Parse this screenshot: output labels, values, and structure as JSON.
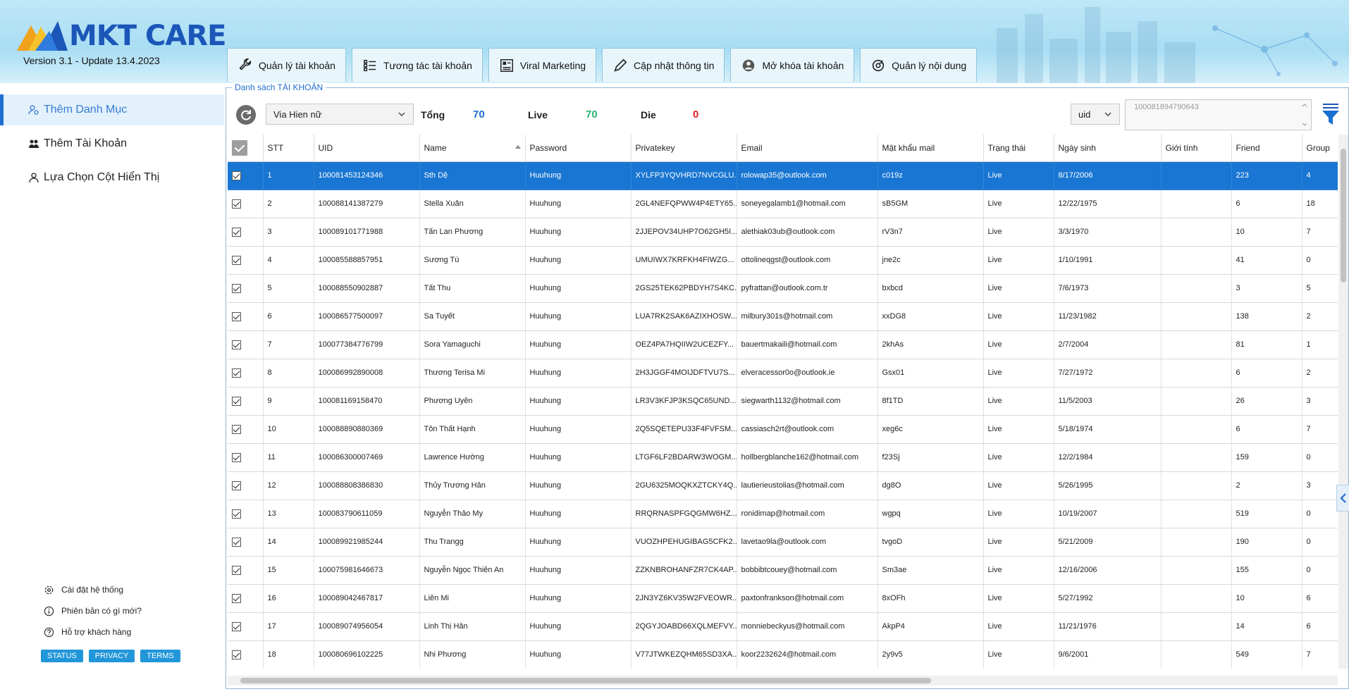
{
  "app": {
    "logo_text": "MKT CARE",
    "version": "Version 3.1 - Update 13.4.2023"
  },
  "tabs": [
    {
      "label": "Quản lý tài khoản",
      "icon": "wrench-icon"
    },
    {
      "label": "Tương tác tài khoản",
      "icon": "list-icon"
    },
    {
      "label": "Viral Marketing",
      "icon": "grid-icon"
    },
    {
      "label": "Cập nhật thông tin",
      "icon": "pencil-icon"
    },
    {
      "label": "Mở khóa tài khoản",
      "icon": "user-circle-icon"
    },
    {
      "label": "Quản lý nội dung",
      "icon": "gear-refresh-icon"
    }
  ],
  "sidebar": {
    "items": [
      {
        "label": "Thêm Danh Mục",
        "icon": "users-cog-icon",
        "active": true
      },
      {
        "label": "Thêm Tài Khoản",
        "icon": "users-icon",
        "active": false
      },
      {
        "label": "Lựa Chọn Cột Hiển Thị",
        "icon": "user-icon",
        "active": false
      }
    ],
    "footer_links": [
      {
        "label": "Cài đặt hệ thống",
        "icon": "gear-icon"
      },
      {
        "label": "Phiên bản có gì mới?",
        "icon": "info-icon"
      },
      {
        "label": "Hỗ trợ khách hàng",
        "icon": "help-icon"
      }
    ],
    "badges": [
      "STATUS",
      "PRIVACY",
      "TERMS"
    ]
  },
  "panel": {
    "legend": "Danh sách TÀI KHOẢN",
    "category_select": "Via Hien nữ",
    "total_label": "Tổng",
    "total_value": "70",
    "live_label": "Live",
    "live_value": "70",
    "die_label": "Die",
    "die_value": "0",
    "search_field_select": "uid",
    "uid_text": "100081894790643",
    "colors": {
      "total": "#1f6fd1",
      "live": "#2bb673",
      "die": "#e02020",
      "selected_row": "#1976d2"
    }
  },
  "table": {
    "columns": [
      "STT",
      "UID",
      "Name",
      "Password",
      "Privatekey",
      "Email",
      "Mật khẩu mail",
      "Trạng thái",
      "Ngày sinh",
      "Giới tính",
      "Friend",
      "Group"
    ],
    "rows": [
      [
        "1",
        "100081453124346",
        "Sth Dệ",
        "Huuhung",
        "XYLFP3YQVHRD7NVCGLU...",
        "rolowap35@outlook.com",
        "c019z",
        "Live",
        "8/17/2006",
        "",
        "223",
        "4"
      ],
      [
        "2",
        "100088141387279",
        "Stella Xuân",
        "Huuhung",
        "2GL4NEFQPWW4P4ETY65...",
        "soneyegalamb1@hotmail.com",
        "sB5GM",
        "Live",
        "12/22/1975",
        "",
        "6",
        "18"
      ],
      [
        "3",
        "100089101771988",
        "Tấn Lan Phương",
        "Huuhung",
        "2JJEPOV34UHP7O62GH5I...",
        "alethiak03ub@outlook.com",
        "rV3n7",
        "Live",
        "3/3/1970",
        "",
        "10",
        "7"
      ],
      [
        "4",
        "100085588857951",
        "Sương Tú",
        "Huuhung",
        "UMUIWX7KRFKH4FIWZG...",
        "ottolineqgst@outlook.com",
        "jne2c",
        "Live",
        "1/10/1991",
        "",
        "41",
        "0"
      ],
      [
        "5",
        "100088550902887",
        "Tất Thu",
        "Huuhung",
        "2GS25TEK62PBDYH7S4KC...",
        "pyfrattan@outlook.com.tr",
        "bxbcd",
        "Live",
        "7/6/1973",
        "",
        "3",
        "5"
      ],
      [
        "6",
        "100086577500097",
        "Sa Tuyết",
        "Huuhung",
        "LUA7RK2SAK6AZIXHOSW...",
        "milbury301s@hotmail.com",
        "xxDG8",
        "Live",
        "11/23/1982",
        "",
        "138",
        "2"
      ],
      [
        "7",
        "100077384776799",
        "Sora Yamaguchi",
        "Huuhung",
        "OEZ4PA7HQIIW2UCEZFY...",
        "bauertmakaili@hotmail.com",
        "2khAs",
        "Live",
        "2/7/2004",
        "",
        "81",
        "1"
      ],
      [
        "8",
        "100086992890008",
        "Thương Terisa Mi",
        "Huuhung",
        "2H3JGGF4MOIJDFTVU7S...",
        "elveracessor0o@outlook.ie",
        "Gsx01",
        "Live",
        "7/27/1972",
        "",
        "6",
        "2"
      ],
      [
        "9",
        "100081169158470",
        "Phương Uyên",
        "Huuhung",
        "LR3V3KFJP3KSQC65UND...",
        "siegwarth1132@hotmail.com",
        "8f1TD",
        "Live",
        "11/5/2003",
        "",
        "26",
        "3"
      ],
      [
        "10",
        "100088890880369",
        "Tôn Thất Hạnh",
        "Huuhung",
        "2Q5SQETEPU33F4FVFSM...",
        "cassiasch2rt@outlook.com",
        "xeg6c",
        "Live",
        "5/18/1974",
        "",
        "6",
        "7"
      ],
      [
        "11",
        "100086300007469",
        "Lawrence Hường",
        "Huuhung",
        "LTGF6LF2BDARW3WOGM...",
        "hollbergblanche162@hotmail.com",
        "f23Sj",
        "Live",
        "12/2/1984",
        "",
        "159",
        "0"
      ],
      [
        "12",
        "100088808386830",
        "Thủy Trương Hân",
        "Huuhung",
        "2GU6325MOQKXZTCKY4Q...",
        "lautierieustolias@hotmail.com",
        "dg8O",
        "Live",
        "5/26/1995",
        "",
        "2",
        "3"
      ],
      [
        "13",
        "100083790611059",
        "Nguyễn Thảo My",
        "Huuhung",
        "RRQRNASPFGQGMW6HZ...",
        "ronidimap@hotmail.com",
        "wgpq",
        "Live",
        "10/19/2007",
        "",
        "519",
        "0"
      ],
      [
        "14",
        "100089921985244",
        "Thu Trangg",
        "Huuhung",
        "VUOZHPEHUGIBAG5CFK2...",
        "lavetao9la@outlook.com",
        "tvgoD",
        "Live",
        "5/21/2009",
        "",
        "190",
        "0"
      ],
      [
        "15",
        "100075981646673",
        "Nguyễn Ngọc Thiên An",
        "Huuhung",
        "ZZKNBROHANFZR7CK4AP...",
        "bobbibtcouey@hotmail.com",
        "Sm3ae",
        "Live",
        "12/16/2006",
        "",
        "155",
        "0"
      ],
      [
        "16",
        "100089042467817",
        "Liên Mi",
        "Huuhung",
        "2JN3YZ6KV35W2FVEOWR...",
        "paxtonfrankson@hotmail.com",
        "8xOFh",
        "Live",
        "5/27/1992",
        "",
        "10",
        "6"
      ],
      [
        "17",
        "100089074956054",
        "Linh Thị Hân",
        "Huuhung",
        "2QGYJOABD66XQLMEFVY...",
        "monniebeckyus@hotmail.com",
        "AkpP4",
        "Live",
        "11/21/1976",
        "",
        "14",
        "6"
      ],
      [
        "18",
        "100080696102225",
        "Nhi Phương",
        "Huuhung",
        "V77JTWKEZQHM65SD3XA...",
        "koor2232624@hotmail.com",
        "2y9v5",
        "Live",
        "9/6/2001",
        "",
        "549",
        "7"
      ]
    ]
  }
}
